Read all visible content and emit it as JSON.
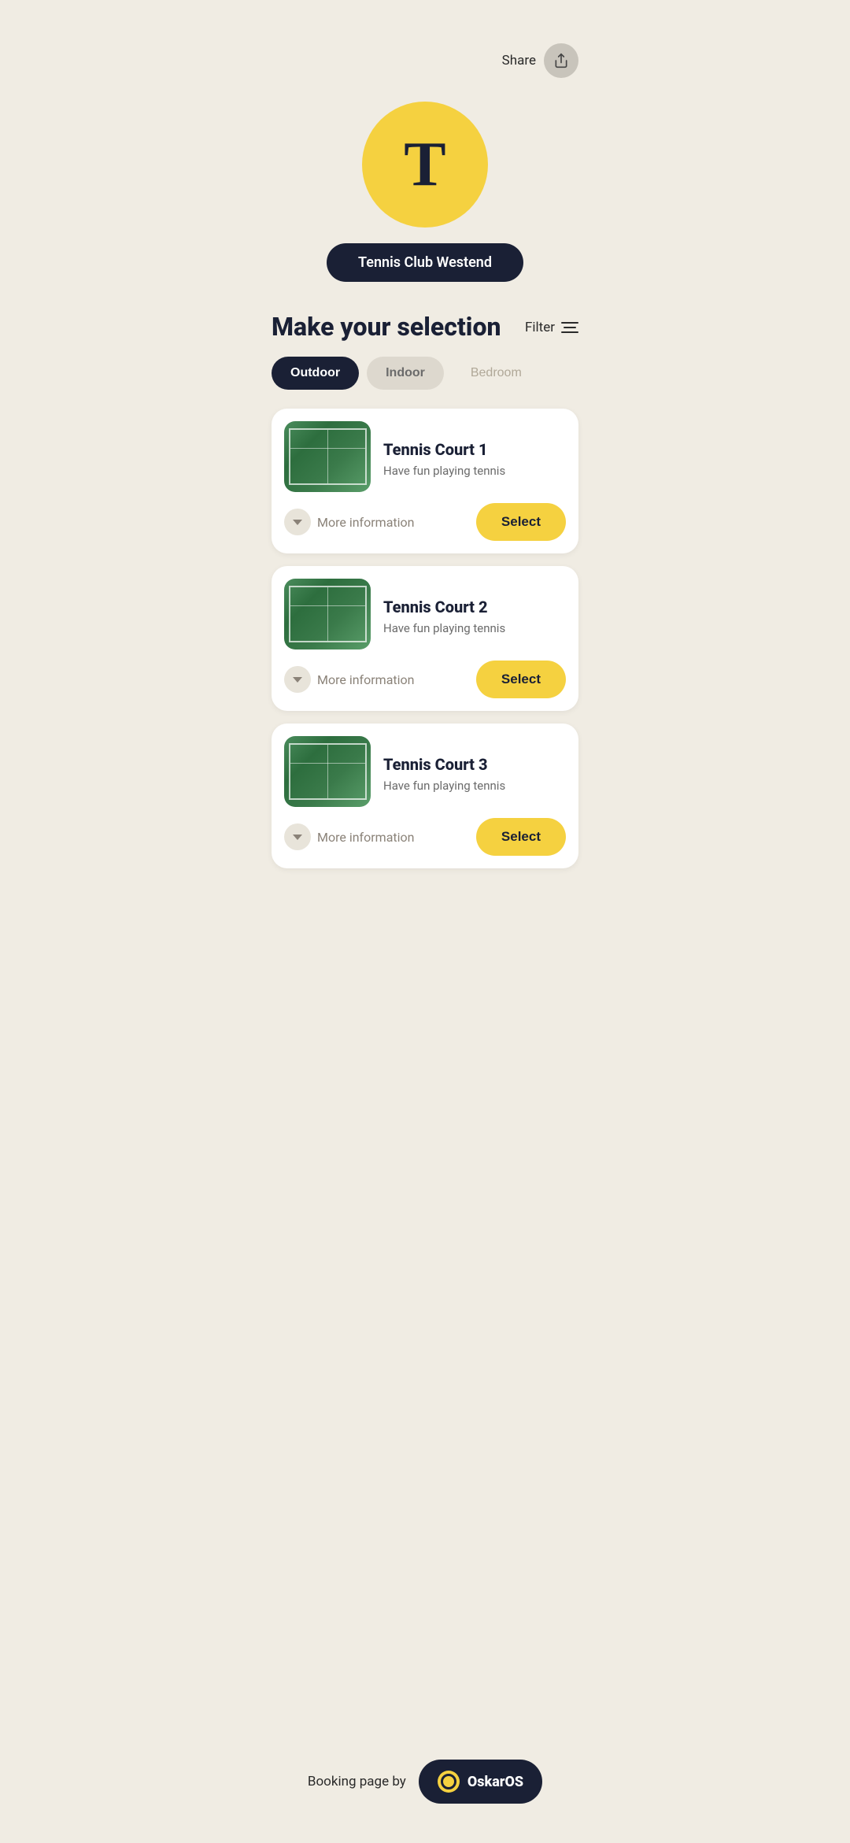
{
  "header": {
    "share_label": "Share"
  },
  "logo": {
    "letter": "T",
    "club_name": "Tennis Club Westend"
  },
  "section": {
    "title": "Make your selection",
    "filter_label": "Filter"
  },
  "tabs": [
    {
      "id": "outdoor",
      "label": "Outdoor",
      "state": "active"
    },
    {
      "id": "indoor",
      "label": "Indoor",
      "state": "inactive"
    },
    {
      "id": "bedroom",
      "label": "Bedroom",
      "state": "faded"
    }
  ],
  "courts": [
    {
      "id": 1,
      "name": "Tennis Court 1",
      "description": "Have fun playing tennis",
      "more_info_label": "More information",
      "select_label": "Select"
    },
    {
      "id": 2,
      "name": "Tennis Court 2",
      "description": "Have fun playing tennis",
      "more_info_label": "More information",
      "select_label": "Select"
    },
    {
      "id": 3,
      "name": "Tennis Court 3",
      "description": "Have fun playing tennis",
      "more_info_label": "More information",
      "select_label": "Select"
    }
  ],
  "footer": {
    "booking_text": "Booking page by",
    "brand_name": "OskarOS"
  }
}
